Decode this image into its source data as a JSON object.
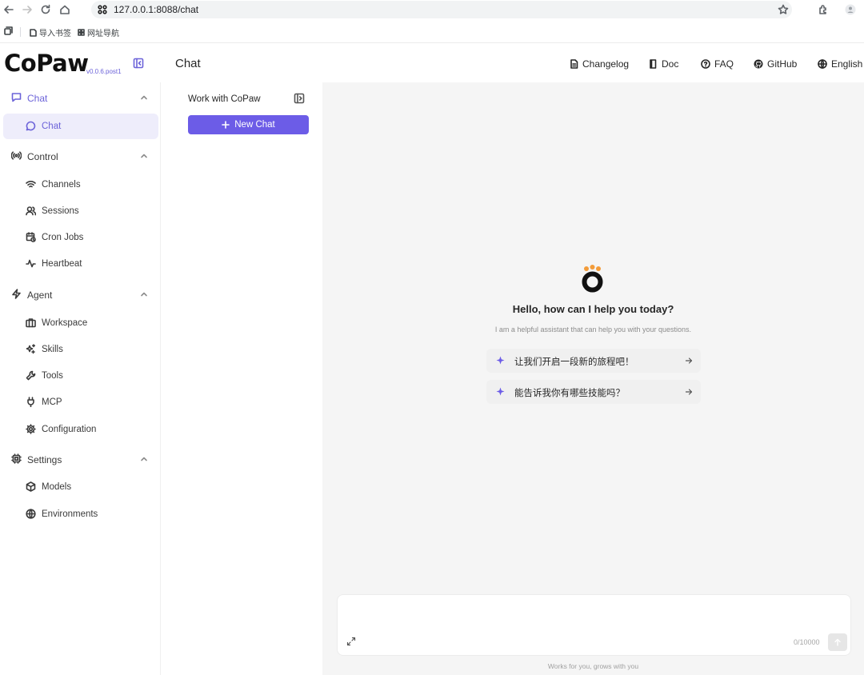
{
  "browser": {
    "url": "127.0.0.1:8088/chat",
    "bookmarks": [
      "导入书签",
      "网址导航"
    ]
  },
  "header": {
    "logo": "CoPaw",
    "version": "v0.0.6.post1",
    "page_title": "Chat",
    "links": [
      {
        "label": "Changelog",
        "icon": "file-icon"
      },
      {
        "label": "Doc",
        "icon": "book-icon"
      },
      {
        "label": "FAQ",
        "icon": "help-circle-icon"
      },
      {
        "label": "GitHub",
        "icon": "github-icon"
      },
      {
        "label": "English",
        "icon": "globe-icon"
      }
    ]
  },
  "sidebar": {
    "groups": [
      {
        "label": "Chat",
        "icon": "message-icon",
        "items": [
          {
            "label": "Chat",
            "icon": "message-circle-icon",
            "active": true
          }
        ]
      },
      {
        "label": "Control",
        "icon": "broadcast-icon",
        "items": [
          {
            "label": "Channels",
            "icon": "wifi-icon"
          },
          {
            "label": "Sessions",
            "icon": "users-icon"
          },
          {
            "label": "Cron Jobs",
            "icon": "calendar-clock-icon"
          },
          {
            "label": "Heartbeat",
            "icon": "activity-icon"
          }
        ]
      },
      {
        "label": "Agent",
        "icon": "zap-icon",
        "items": [
          {
            "label": "Workspace",
            "icon": "briefcase-icon"
          },
          {
            "label": "Skills",
            "icon": "sparkles-icon"
          },
          {
            "label": "Tools",
            "icon": "wrench-icon"
          },
          {
            "label": "MCP",
            "icon": "plug-icon"
          },
          {
            "label": "Configuration",
            "icon": "gear-icon"
          }
        ]
      },
      {
        "label": "Settings",
        "icon": "cpu-icon",
        "items": [
          {
            "label": "Models",
            "icon": "box-icon"
          },
          {
            "label": "Environments",
            "icon": "globe-icon"
          }
        ]
      }
    ]
  },
  "chatlist": {
    "title": "Work with CoPaw",
    "new_chat": "New Chat"
  },
  "main": {
    "greeting": "Hello, how can I help you today?",
    "subtitle": "I am a helpful assistant that can help you with your questions.",
    "prompts": [
      "让我们开启一段新的旅程吧！",
      "能告诉我你有哪些技能吗？"
    ],
    "input_placeholder": "",
    "counter": "0/10000",
    "footer": "Works for you, grows with you"
  },
  "colors": {
    "accent": "#6c5ce7",
    "paw_orange": "#f39c3a",
    "active_bg": "#eeedfb"
  }
}
